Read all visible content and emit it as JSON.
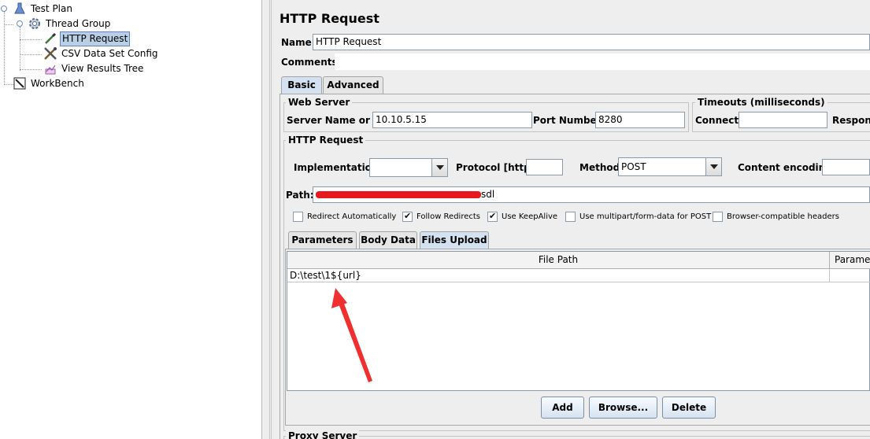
{
  "tree": {
    "test_plan": "Test Plan",
    "thread_group": "Thread Group",
    "http_request": "HTTP Request",
    "csv_config": "CSV Data Set Config",
    "results_tree": "View Results Tree",
    "workbench": "WorkBench"
  },
  "panel": {
    "title": "HTTP Request",
    "name_label": "Name:",
    "name_value": "HTTP Request",
    "comments_label": "Comments:",
    "tabs": [
      "Basic",
      "Advanced"
    ],
    "web_server": {
      "legend": "Web Server",
      "server_label": "Server Name or IP:",
      "server_value": "10.10.5.15",
      "port_label": "Port Number:",
      "port_value": "8280"
    },
    "timeouts": {
      "legend": "Timeouts (milliseconds)",
      "connect_label": "Connect:",
      "response_label": "Respons"
    },
    "http_request": {
      "legend": "HTTP Request",
      "implementation_label": "Implementation:",
      "implementation_value": "",
      "protocol_label": "Protocol [http]:",
      "protocol_value": "",
      "method_label": "Method:",
      "method_value": "POST",
      "encoding_label": "Content encoding:",
      "path_label": "Path:",
      "path_value_suffix": "sdl"
    },
    "checkboxes": [
      {
        "label": "Redirect Automatically",
        "checked": false
      },
      {
        "label": "Follow Redirects",
        "checked": true
      },
      {
        "label": "Use KeepAlive",
        "checked": true
      },
      {
        "label": "Use multipart/form-data for POST",
        "checked": false
      },
      {
        "label": "Browser-compatible headers",
        "checked": false
      }
    ],
    "sub_tabs": [
      "Parameters",
      "Body Data",
      "Files Upload"
    ],
    "files_table": {
      "columns": [
        "File Path",
        "Parame"
      ],
      "rows": [
        [
          "D:\\test\\1${url}",
          ""
        ]
      ]
    },
    "buttons": {
      "add": "Add",
      "browse": "Browse...",
      "delete": "Delete"
    },
    "proxy_legend": "Proxy Server"
  },
  "colors": {
    "selection": "#b8cfe5",
    "redaction": "#e8191c",
    "arrow": "#f03030"
  }
}
